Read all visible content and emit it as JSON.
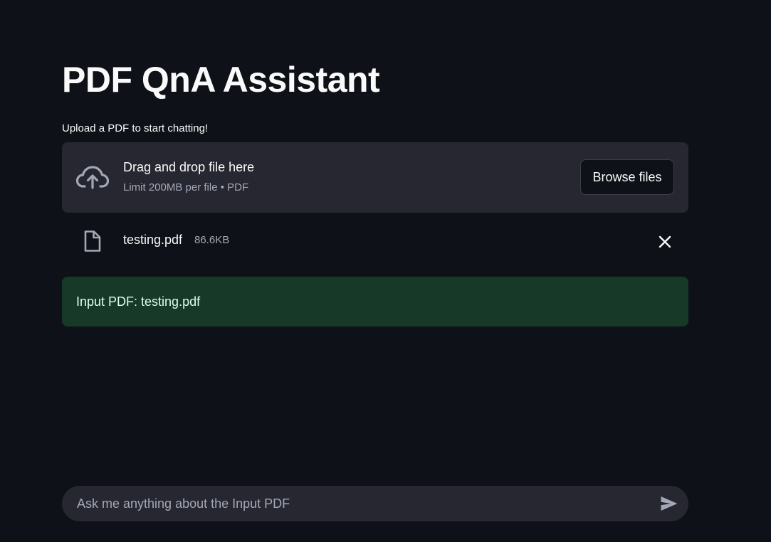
{
  "page": {
    "title": "PDF QnA Assistant"
  },
  "uploader": {
    "label": "Upload a PDF to start chatting!",
    "drop_title": "Drag and drop file here",
    "drop_subtitle": "Limit 200MB per file • PDF",
    "browse_label": "Browse files",
    "upload_icon": "cloud-upload-icon"
  },
  "uploaded_file": {
    "name": "testing.pdf",
    "size": "86.6KB",
    "file_icon": "file-icon",
    "remove_icon": "close-icon"
  },
  "status": {
    "message": "Input PDF: testing.pdf",
    "color": "#173928"
  },
  "chat": {
    "placeholder": "Ask me anything about the Input PDF",
    "send_icon": "send-icon"
  },
  "theme": {
    "background": "#0e1117",
    "surface": "#262730",
    "text": "#fafafa",
    "muted_text": "#a3a8b8"
  }
}
